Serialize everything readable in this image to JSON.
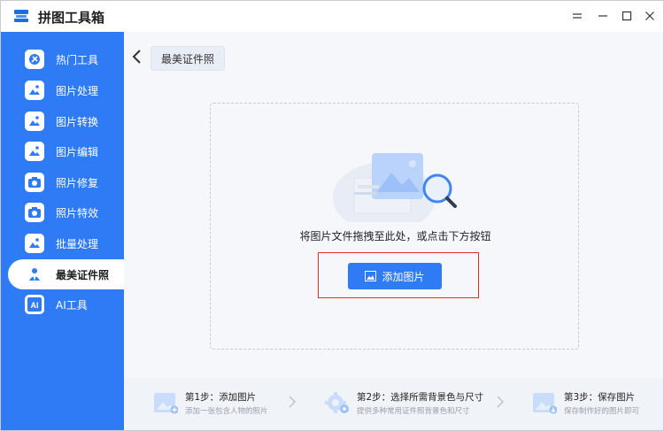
{
  "app": {
    "title": "拼图工具箱"
  },
  "window_controls": [
    "minimize-icon",
    "restore-down-icon",
    "maximize-icon",
    "close-icon"
  ],
  "sidebar": {
    "items": [
      {
        "label": "热门工具",
        "icon": "tools-icon"
      },
      {
        "label": "图片处理",
        "icon": "image-process-icon"
      },
      {
        "label": "图片转换",
        "icon": "image-convert-icon"
      },
      {
        "label": "图片编辑",
        "icon": "image-edit-icon"
      },
      {
        "label": "照片修复",
        "icon": "photo-repair-icon"
      },
      {
        "label": "照片特效",
        "icon": "photo-effect-icon"
      },
      {
        "label": "批量处理",
        "icon": "batch-icon"
      },
      {
        "label": "最美证件照",
        "icon": "id-photo-icon",
        "active": true
      },
      {
        "label": "AI工具",
        "icon": "ai-icon"
      }
    ]
  },
  "main": {
    "tab_label": "最美证件照",
    "drop_hint": "将图片文件拖拽至此处，或点击下方按钮",
    "add_button": "添加图片"
  },
  "steps": [
    {
      "title": "第1步：添加图片",
      "desc": "添加一张包含人物的照片",
      "icon": "add-photo-icon"
    },
    {
      "title": "第2步：选择所需背景色与尺寸",
      "desc": "提供多种常用证件照背景色和尺寸",
      "icon": "settings-gear-icon"
    },
    {
      "title": "第3步：保存图片",
      "desc": "保存制作好的图片即可",
      "icon": "save-image-icon"
    }
  ],
  "colors": {
    "accent": "#2f7bf5",
    "highlight": "#d9302b"
  }
}
